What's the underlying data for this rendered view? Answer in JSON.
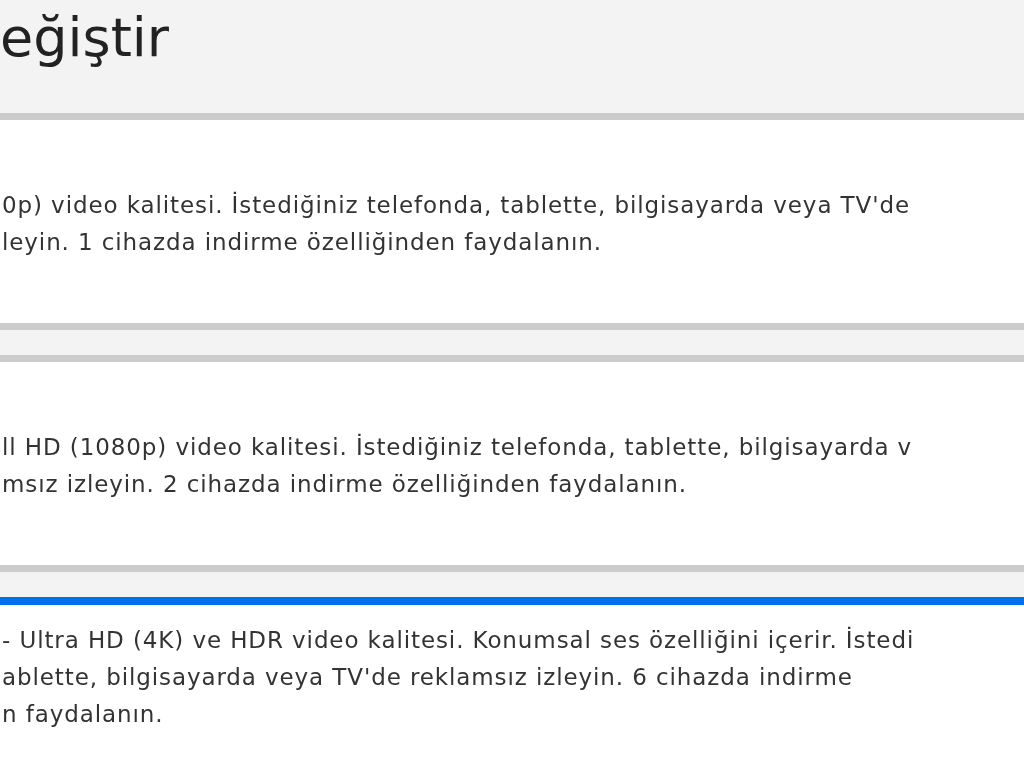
{
  "page": {
    "title": "eğiştir"
  },
  "plans": [
    {
      "selected": false,
      "description_lines": [
        "0p) video kalitesi. İstediğiniz telefonda, tablette, bilgisayarda veya TV'de",
        "leyin. 1 cihazda indirme özelliğinden faydalanın."
      ]
    },
    {
      "selected": false,
      "description_lines": [
        "ll HD (1080p) video kalitesi. İstediğiniz telefonda, tablette, bilgisayarda v",
        "msız izleyin. 2 cihazda indirme özelliğinden faydalanın."
      ]
    },
    {
      "selected": true,
      "description_lines": [
        "- Ultra HD (4K) ve HDR video kalitesi. Konumsal ses özelliğini içerir. İstedi",
        "ablette, bilgisayarda veya TV'de reklamsız izleyin. 6 cihazda indirme",
        "n faydalanın."
      ]
    }
  ]
}
